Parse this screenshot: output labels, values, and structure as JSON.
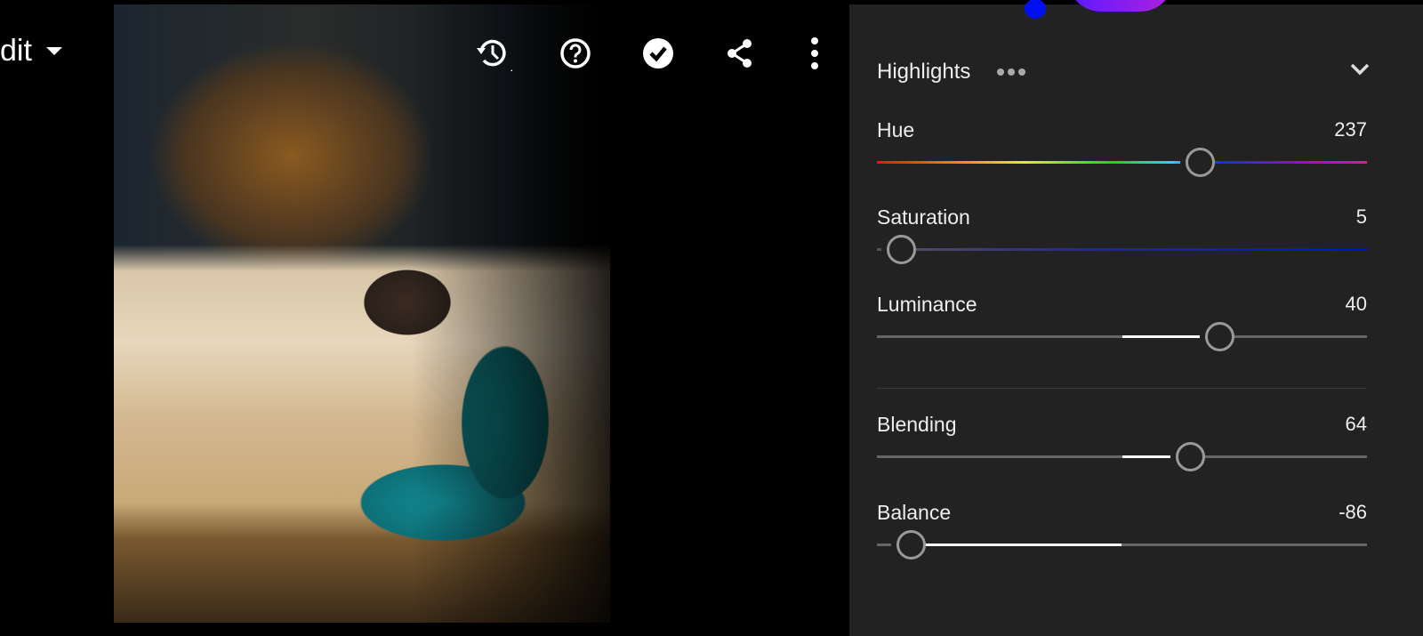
{
  "header": {
    "edit_label": "dit"
  },
  "toolbar": {
    "icons": [
      "history-icon",
      "help-icon",
      "done-check-icon",
      "share-icon",
      "more-vertical-icon"
    ]
  },
  "panel": {
    "section_title": "Highlights",
    "sliders": [
      {
        "label": "Hue",
        "value": "237",
        "num": 237,
        "min": 0,
        "max": 359,
        "track": "hue"
      },
      {
        "label": "Saturation",
        "value": "5",
        "num": 5,
        "min": 0,
        "max": 100,
        "track": "saturation"
      },
      {
        "label": "Luminance",
        "value": "40",
        "num": 40,
        "min": -100,
        "max": 100,
        "track": "center"
      },
      {
        "label": "Blending",
        "value": "64",
        "num": 64,
        "min": 0,
        "max": 100,
        "track": "center"
      },
      {
        "label": "Balance",
        "value": "-86",
        "num": -86,
        "min": -100,
        "max": 100,
        "track": "center"
      }
    ]
  },
  "colors": {
    "panel_bg": "#222222",
    "knob": "#999999",
    "fill": "#ffffff"
  }
}
